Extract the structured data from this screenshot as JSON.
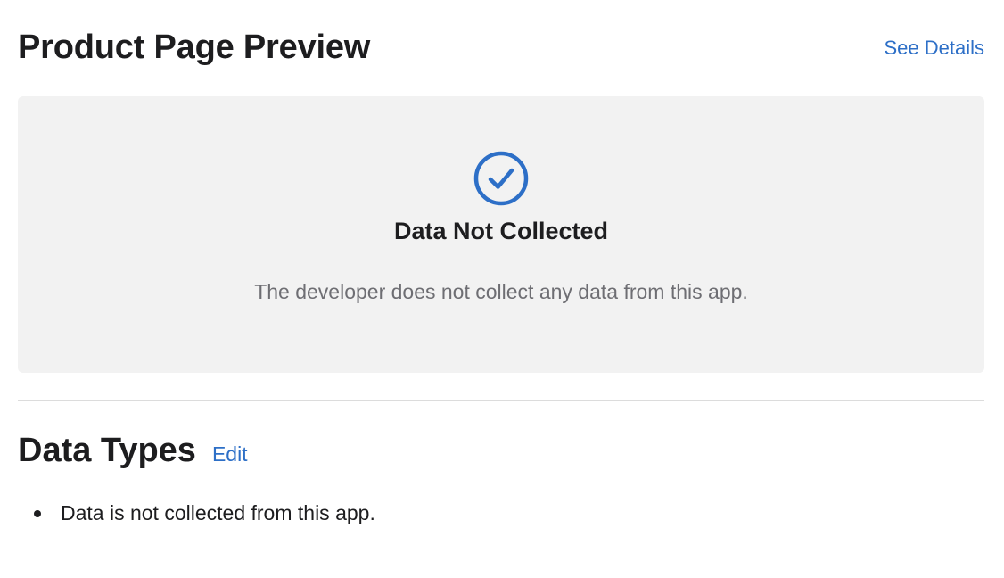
{
  "header": {
    "title": "Product Page Preview",
    "see_details_label": "See Details"
  },
  "preview_card": {
    "icon": "checkmark-circle-icon",
    "title": "Data Not Collected",
    "description": "The developer does not collect any data from this app."
  },
  "data_types": {
    "title": "Data Types",
    "edit_label": "Edit",
    "items": [
      {
        "label": "Data is not collected from this app."
      }
    ]
  },
  "colors": {
    "accent": "#2d6fc7",
    "card_background": "#f2f2f2",
    "text_primary": "#1d1d1f",
    "text_secondary": "#6e6e73",
    "divider": "#dcdcdc"
  }
}
